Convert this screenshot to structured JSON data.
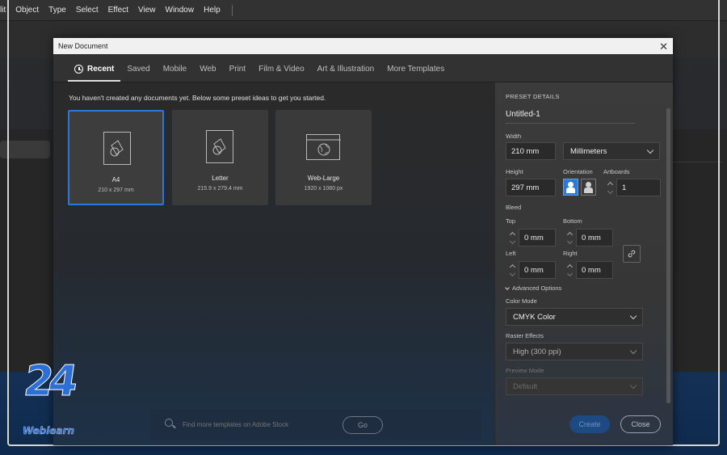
{
  "menubar": {
    "items": [
      "lit",
      "Object",
      "Type",
      "Select",
      "Effect",
      "View",
      "Window",
      "Help"
    ]
  },
  "dialog": {
    "title": "New Document",
    "tabs": [
      "Recent",
      "Saved",
      "Mobile",
      "Web",
      "Print",
      "Film & Video",
      "Art & Illustration",
      "More Templates"
    ],
    "intro": "You haven't created any documents yet. Below some preset ideas to get you started.",
    "presets": [
      {
        "name": "A4",
        "dims": "210 x 297 mm",
        "icon": "page-shape-icon"
      },
      {
        "name": "Letter",
        "dims": "215.9 x 279.4 mm",
        "icon": "page-shape-icon"
      },
      {
        "name": "Web-Large",
        "dims": "1920 x 1080 px",
        "icon": "web-globe-icon"
      }
    ],
    "search": {
      "placeholder": "Find more templates on Adobe Stock",
      "go_label": "Go"
    }
  },
  "preset_details": {
    "heading": "PRESET DETAILS",
    "doc_name": "Untitled-1",
    "width_label": "Width",
    "width_value": "210 mm",
    "unit": "Millimeters",
    "height_label": "Height",
    "height_value": "297 mm",
    "orientation_label": "Orientation",
    "artboards_label": "Artboards",
    "artboards_value": "1",
    "bleed_label": "Bleed",
    "top_label": "Top",
    "top_value": "0 mm",
    "bottom_label": "Bottom",
    "bottom_value": "0 mm",
    "left_label": "Left",
    "left_value": "0 mm",
    "right_label": "Right",
    "right_value": "0 mm",
    "advanced_label": "Advanced Options",
    "color_mode_label": "Color Mode",
    "color_mode_value": "CMYK Color",
    "raster_label": "Raster Effects",
    "raster_value": "High (300 ppi)",
    "preview_label": "Preview Mode",
    "preview_value": "Default",
    "create_label": "Create",
    "close_label": "Close"
  },
  "logo": {
    "number": "24",
    "word": "Weblearn"
  },
  "colors": {
    "accent": "#2d77d6",
    "brand": "#2c6fd6"
  }
}
